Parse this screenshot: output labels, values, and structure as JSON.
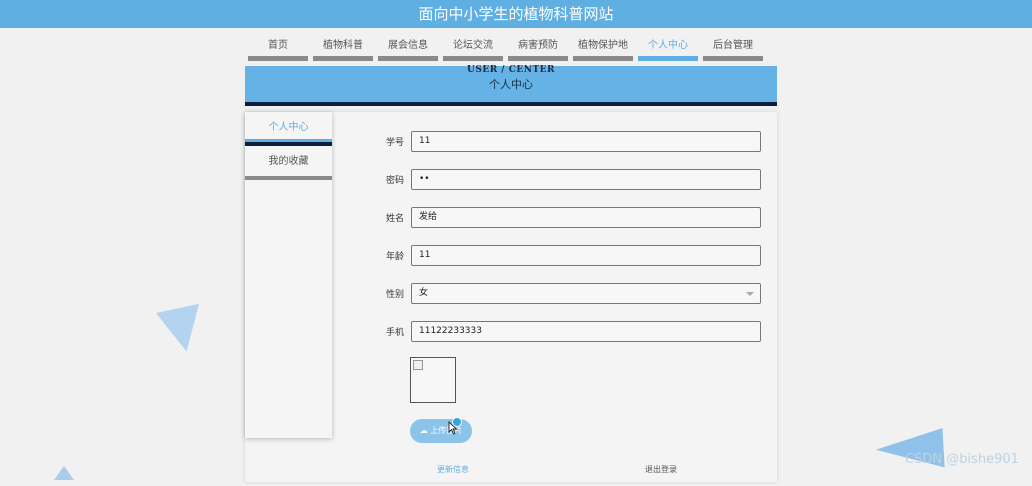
{
  "site_title": "面向中小学生的植物科普网站",
  "nav": {
    "items": [
      {
        "label": "首页"
      },
      {
        "label": "植物科普"
      },
      {
        "label": "展会信息"
      },
      {
        "label": "论坛交流"
      },
      {
        "label": "病害预防"
      },
      {
        "label": "植物保护地"
      },
      {
        "label": "个人中心"
      },
      {
        "label": "后台管理"
      }
    ],
    "active_index": 6
  },
  "banner": {
    "en": "USER / CENTER",
    "cn": "个人中心"
  },
  "sidebar": {
    "items": [
      {
        "label": "个人中心"
      },
      {
        "label": "我的收藏"
      }
    ],
    "active_index": 0
  },
  "form": {
    "fields": [
      {
        "label": "学号",
        "value": "11"
      },
      {
        "label": "密码",
        "value": "••"
      },
      {
        "label": "姓名",
        "value": "发给"
      },
      {
        "label": "年龄",
        "value": "11"
      },
      {
        "label": "性别",
        "value": "女"
      },
      {
        "label": "手机",
        "value": "11122233333"
      }
    ],
    "upload_label": "上传图片",
    "update_label": "更新信息",
    "logout_label": "退出登录"
  },
  "watermark": "CSDN @bishe901",
  "colors": {
    "accent": "#5fafe3",
    "dark": "#0d1e3d",
    "nav_inactive": "#8a8a8a"
  }
}
